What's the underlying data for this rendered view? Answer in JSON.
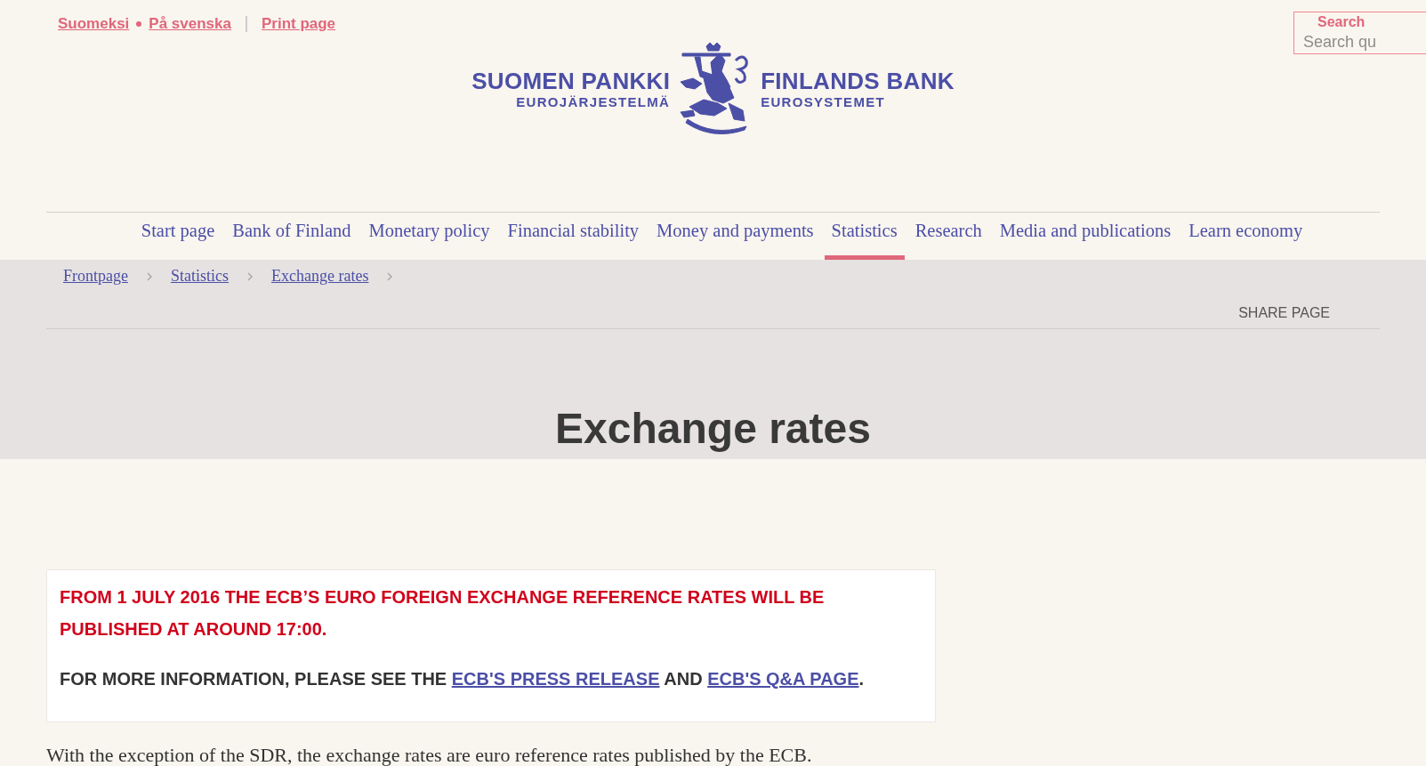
{
  "top_links": [
    {
      "label": "Suomeksi"
    },
    {
      "label": "På svenska"
    },
    {
      "label": "Print page"
    }
  ],
  "search": {
    "label": "Search",
    "placeholder": "Search qu"
  },
  "logo": {
    "left_name": "SUOMEN PANKKI",
    "left_sub": "EUROJÄRJESTELMÄ",
    "right_name": "FINLANDS BANK",
    "right_sub": "EUROSYSTEMET"
  },
  "nav": [
    {
      "label": "Start page",
      "selected": false
    },
    {
      "label": "Bank of Finland",
      "selected": false
    },
    {
      "label": "Monetary policy",
      "selected": false
    },
    {
      "label": "Financial stability",
      "selected": false
    },
    {
      "label": "Money and payments",
      "selected": false
    },
    {
      "label": "Statistics",
      "selected": true
    },
    {
      "label": "Research",
      "selected": false
    },
    {
      "label": "Media and publications",
      "selected": false
    },
    {
      "label": "Learn economy",
      "selected": false
    }
  ],
  "breadcrumb": [
    {
      "label": "Frontpage"
    },
    {
      "label": "Statistics"
    },
    {
      "label": "Exchange rates"
    }
  ],
  "share": "SHARE PAGE",
  "title": "Exchange rates",
  "notice": {
    "headline": "FROM 1 JULY 2016 THE ECB’S EURO FOREIGN EXCHANGE REFERENCE RATES WILL BE PUBLISHED AT AROUND 17:00.",
    "info": [
      {
        "kind": "text",
        "text": "FOR MORE INFORMATION, PLEASE SEE THE "
      },
      {
        "kind": "link",
        "text": "ECB'S PRESS RELEASE"
      },
      {
        "kind": "text",
        "text": " AND "
      },
      {
        "kind": "link",
        "text": "ECB'S Q&A PAGE"
      },
      {
        "kind": "text",
        "text": "."
      }
    ]
  },
  "intro": "With the exception of the SDR, the exchange rates are euro reference rates published by the ECB."
}
